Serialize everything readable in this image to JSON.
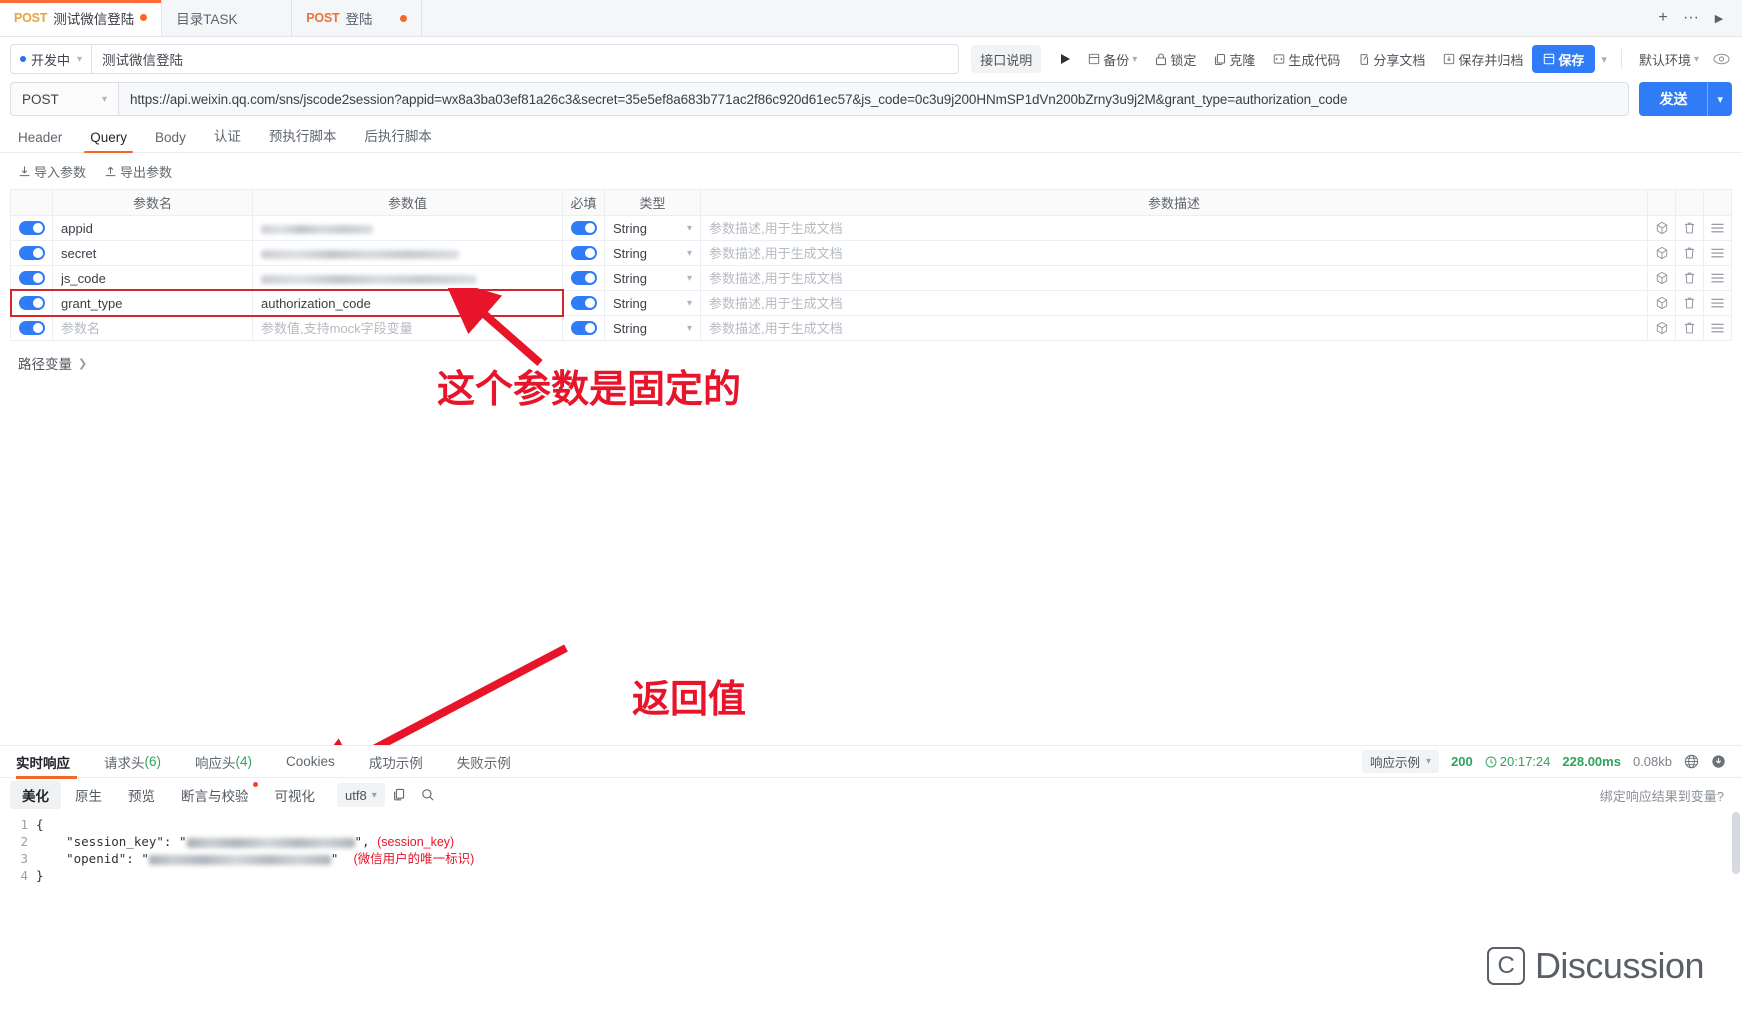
{
  "tabbar": {
    "tabs": [
      {
        "method": "POST",
        "name": "测试微信登陆",
        "dirty": true,
        "active": true
      },
      {
        "method": "",
        "name": "目录TASK",
        "dirty": false,
        "active": false
      },
      {
        "method": "POST",
        "name": "登陆",
        "dirty": true,
        "active": false
      }
    ],
    "actions": {
      "add": "+",
      "more": "···",
      "next": "▶"
    }
  },
  "toolbar": {
    "status": "开发中",
    "api_name": "测试微信登陆",
    "doc_label": "接口说明",
    "run_icon": "play-icon",
    "backup": "备份",
    "lock": "锁定",
    "clone": "克隆",
    "gencode": "生成代码",
    "sharedoc": "分享文档",
    "save_archive": "保存并归档",
    "save": "保存",
    "env": "默认环境",
    "eye_icon": "eye-icon"
  },
  "request": {
    "method": "POST",
    "url": "https://api.weixin.qq.com/sns/jscode2session?appid=wx8a3ba03ef81a26c3&secret=35e5ef8a683b771ac2f86c920d61ec57&js_code=0c3u9j200HNmSP1dVn200bZrny3u9j2M&grant_type=authorization_code",
    "send": "发送",
    "tabs": [
      {
        "label": "Header",
        "active": false
      },
      {
        "label": "Query",
        "active": true
      },
      {
        "label": "Body",
        "active": false
      },
      {
        "label": "认证",
        "active": false
      },
      {
        "label": "预执行脚本",
        "active": false
      },
      {
        "label": "后执行脚本",
        "active": false
      }
    ],
    "import_params": "导入参数",
    "export_params": "导出参数",
    "path_vars": "路径变量"
  },
  "param_table": {
    "headers": [
      "",
      "参数名",
      "参数值",
      "必填",
      "类型",
      "参数描述",
      "",
      "",
      ""
    ],
    "desc_placeholder": "参数描述,用于生成文档",
    "name_placeholder": "参数名",
    "value_placeholder": "参数值,支持mock字段变量",
    "rows": [
      {
        "enabled": true,
        "name": "appid",
        "value": "",
        "redacted": true,
        "redacted_w": 112,
        "required": true,
        "type": "String",
        "desc": ""
      },
      {
        "enabled": true,
        "name": "secret",
        "value": "",
        "redacted": true,
        "redacted_w": 198,
        "required": true,
        "type": "String",
        "desc": ""
      },
      {
        "enabled": true,
        "name": "js_code",
        "value": "",
        "redacted": true,
        "redacted_w": 216,
        "required": true,
        "type": "String",
        "desc": ""
      },
      {
        "enabled": true,
        "name": "grant_type",
        "value": "authorization_code",
        "redacted": false,
        "required": true,
        "type": "String",
        "desc": "",
        "highlighted": true
      },
      {
        "enabled": true,
        "name": "",
        "value": "",
        "redacted": false,
        "required": true,
        "type": "String",
        "desc": "",
        "is_new": true
      }
    ],
    "row_icons": [
      "cube-icon",
      "trash-icon",
      "drag-handle-icon"
    ]
  },
  "annotations": [
    {
      "text": "这个参数是固定的",
      "color": "#e8142a"
    },
    {
      "text": "返回值",
      "color": "#e8142a"
    }
  ],
  "response": {
    "tabs": [
      {
        "label": "实时响应",
        "count": "",
        "active": true
      },
      {
        "label": "请求头",
        "count": "(6)",
        "active": false
      },
      {
        "label": "响应头",
        "count": "(4)",
        "active": false
      },
      {
        "label": "Cookies",
        "count": "",
        "active": false
      },
      {
        "label": "成功示例",
        "count": "",
        "active": false
      },
      {
        "label": "失败示例",
        "count": "",
        "active": false
      }
    ],
    "example_select": "响应示例",
    "status_code": "200",
    "time": "20:17:24",
    "duration": "228.00ms",
    "size": "0.08kb",
    "globe_icon": "globe-icon",
    "download_icon": "download-icon",
    "view_tabs": [
      {
        "label": "美化",
        "active": true,
        "dot": false
      },
      {
        "label": "原生",
        "active": false,
        "dot": false
      },
      {
        "label": "预览",
        "active": false,
        "dot": false
      },
      {
        "label": "断言与校验",
        "active": false,
        "dot": true
      },
      {
        "label": "可视化",
        "active": false,
        "dot": false
      }
    ],
    "encoding": "utf8",
    "copy_icon": "copy-icon",
    "search_icon": "search-icon",
    "bind_link": "绑定响应结果到变量?",
    "body": {
      "lines": [
        "1",
        "2",
        "3",
        "4"
      ],
      "line1": "{",
      "line2_key": "    \"session_key\": \"",
      "line2_tail": "\",",
      "line2_comment": "(session_key)",
      "line3_key": "    \"openid\": \"",
      "line3_tail": "\"",
      "line3_comment": "(微信用户的唯一标识)",
      "line4": "}"
    }
  },
  "watermark": {
    "text": "Discussion",
    "mark": "C"
  },
  "colors": {
    "accent_orange": "#f5662a",
    "primary_blue": "#2f7cf6",
    "success_green": "#2fa35c",
    "annotation_red": "#e8142a",
    "tab_post_orange": "#e8a33d"
  }
}
